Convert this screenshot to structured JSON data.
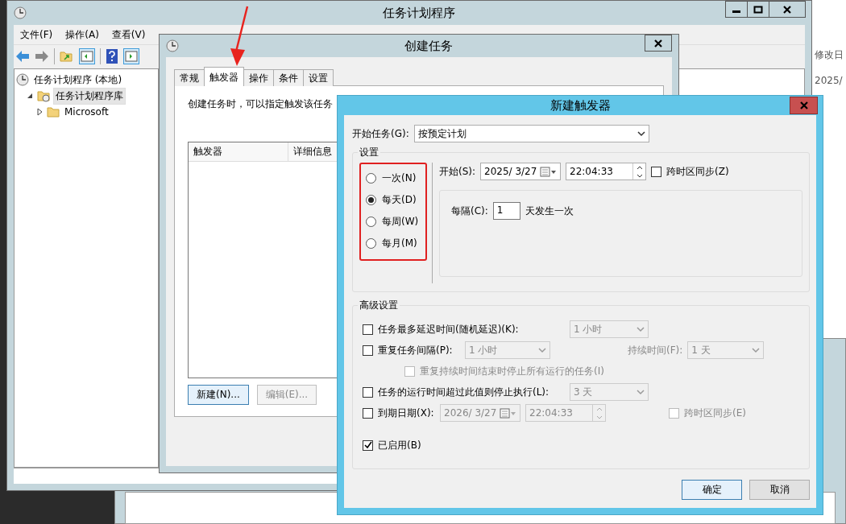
{
  "desktop": {
    "behind_window": {
      "column_header": "修改日",
      "cell": "2025/"
    }
  },
  "main_window": {
    "title": "任务计划程序",
    "menu": [
      "文件(F)",
      "操作(A)",
      "查看(V)"
    ],
    "tree": [
      {
        "label": "任务计划程序 (本地)",
        "selected": false,
        "children": [
          {
            "label": "任务计划程序库",
            "selected": true,
            "expanded": true,
            "children": [
              {
                "label": "Microsoft",
                "selected": false,
                "expanded": false
              }
            ]
          }
        ]
      }
    ]
  },
  "create_task_dialog": {
    "title": "创建任务",
    "tabs": [
      {
        "label": "常规",
        "selected": false
      },
      {
        "label": "触发器",
        "selected": true
      },
      {
        "label": "操作",
        "selected": false
      },
      {
        "label": "条件",
        "selected": false
      },
      {
        "label": "设置",
        "selected": false
      }
    ],
    "description": "创建任务时，可以指定触发该任务",
    "trigger_table": {
      "columns": [
        "触发器",
        "详细信息"
      ]
    },
    "buttons": [
      {
        "label": "新建(N)...",
        "disabled": false
      },
      {
        "label": "编辑(E)...",
        "disabled": true
      }
    ]
  },
  "new_trigger_dialog": {
    "title": "新建触发器",
    "begin_task": {
      "label": "开始任务(G):",
      "value": "按预定计划"
    },
    "settings": {
      "title": "设置",
      "schedules": [
        {
          "label": "一次(N)",
          "selected": false
        },
        {
          "label": "每天(D)",
          "selected": true
        },
        {
          "label": "每周(W)",
          "selected": false
        },
        {
          "label": "每月(M)",
          "selected": false
        }
      ],
      "start": {
        "label": "开始(S):",
        "date": "2025/ 3/27",
        "time": "22:04:33",
        "sync": {
          "label": "跨时区同步(Z)",
          "checked": false
        }
      },
      "recur": {
        "label": "每隔(C):",
        "value": "1",
        "suffix": "天发生一次"
      }
    },
    "advanced": {
      "title": "高级设置",
      "rows": [
        {
          "kind": "delay",
          "checked": false,
          "label": "任务最多延迟时间(随机延迟)(K):",
          "value": "1 小时"
        },
        {
          "kind": "repeat",
          "checked": false,
          "label": "重复任务间隔(P):",
          "value": "1 小时",
          "duration_label": "持续时间(F):",
          "duration_value": "1 天"
        },
        {
          "kind": "stop_all",
          "checked": false,
          "label": "重复持续时间结束时停止所有运行的任务(I)"
        },
        {
          "kind": "limit",
          "checked": false,
          "label": "任务的运行时间超过此值则停止执行(L):",
          "value": "3 天"
        },
        {
          "kind": "expire",
          "checked": false,
          "label": "到期日期(X):",
          "date": "2026/ 3/27",
          "time": "22:04:33",
          "sync_label": "跨时区同步(E)",
          "sync_checked": false
        },
        {
          "kind": "enabled",
          "checked": true,
          "label": "已启用(B)"
        }
      ]
    },
    "buttons": [
      {
        "label": "确定",
        "default": true
      },
      {
        "label": "取消",
        "default": false
      }
    ]
  },
  "annotations": {
    "arrow_to_tab": true,
    "box_around_schedules": true
  }
}
